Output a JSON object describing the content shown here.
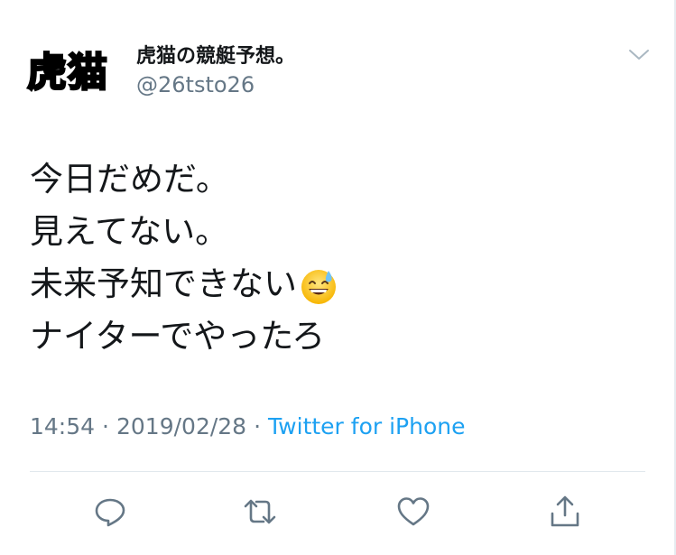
{
  "tweet": {
    "avatar_text": "虎猫",
    "display_name": "虎猫の競艇予想。",
    "handle": "@26tsto26",
    "body_lines": [
      "今日だめだ。",
      "見えてない。",
      "未来予知できない",
      "ナイターでやったろ"
    ],
    "emoji_name": "grinning-face-with-sweat-emoji",
    "time": "14:54",
    "separator": "·",
    "date": "2019/02/28",
    "source": "Twitter for iPhone"
  },
  "colors": {
    "text": "#14171a",
    "secondary": "#657786",
    "link": "#1da1f2",
    "divider": "#e1e8ed"
  },
  "actions": [
    {
      "name": "reply",
      "icon": "reply-icon"
    },
    {
      "name": "retweet",
      "icon": "retweet-icon"
    },
    {
      "name": "like",
      "icon": "heart-icon"
    },
    {
      "name": "share",
      "icon": "share-icon"
    }
  ]
}
